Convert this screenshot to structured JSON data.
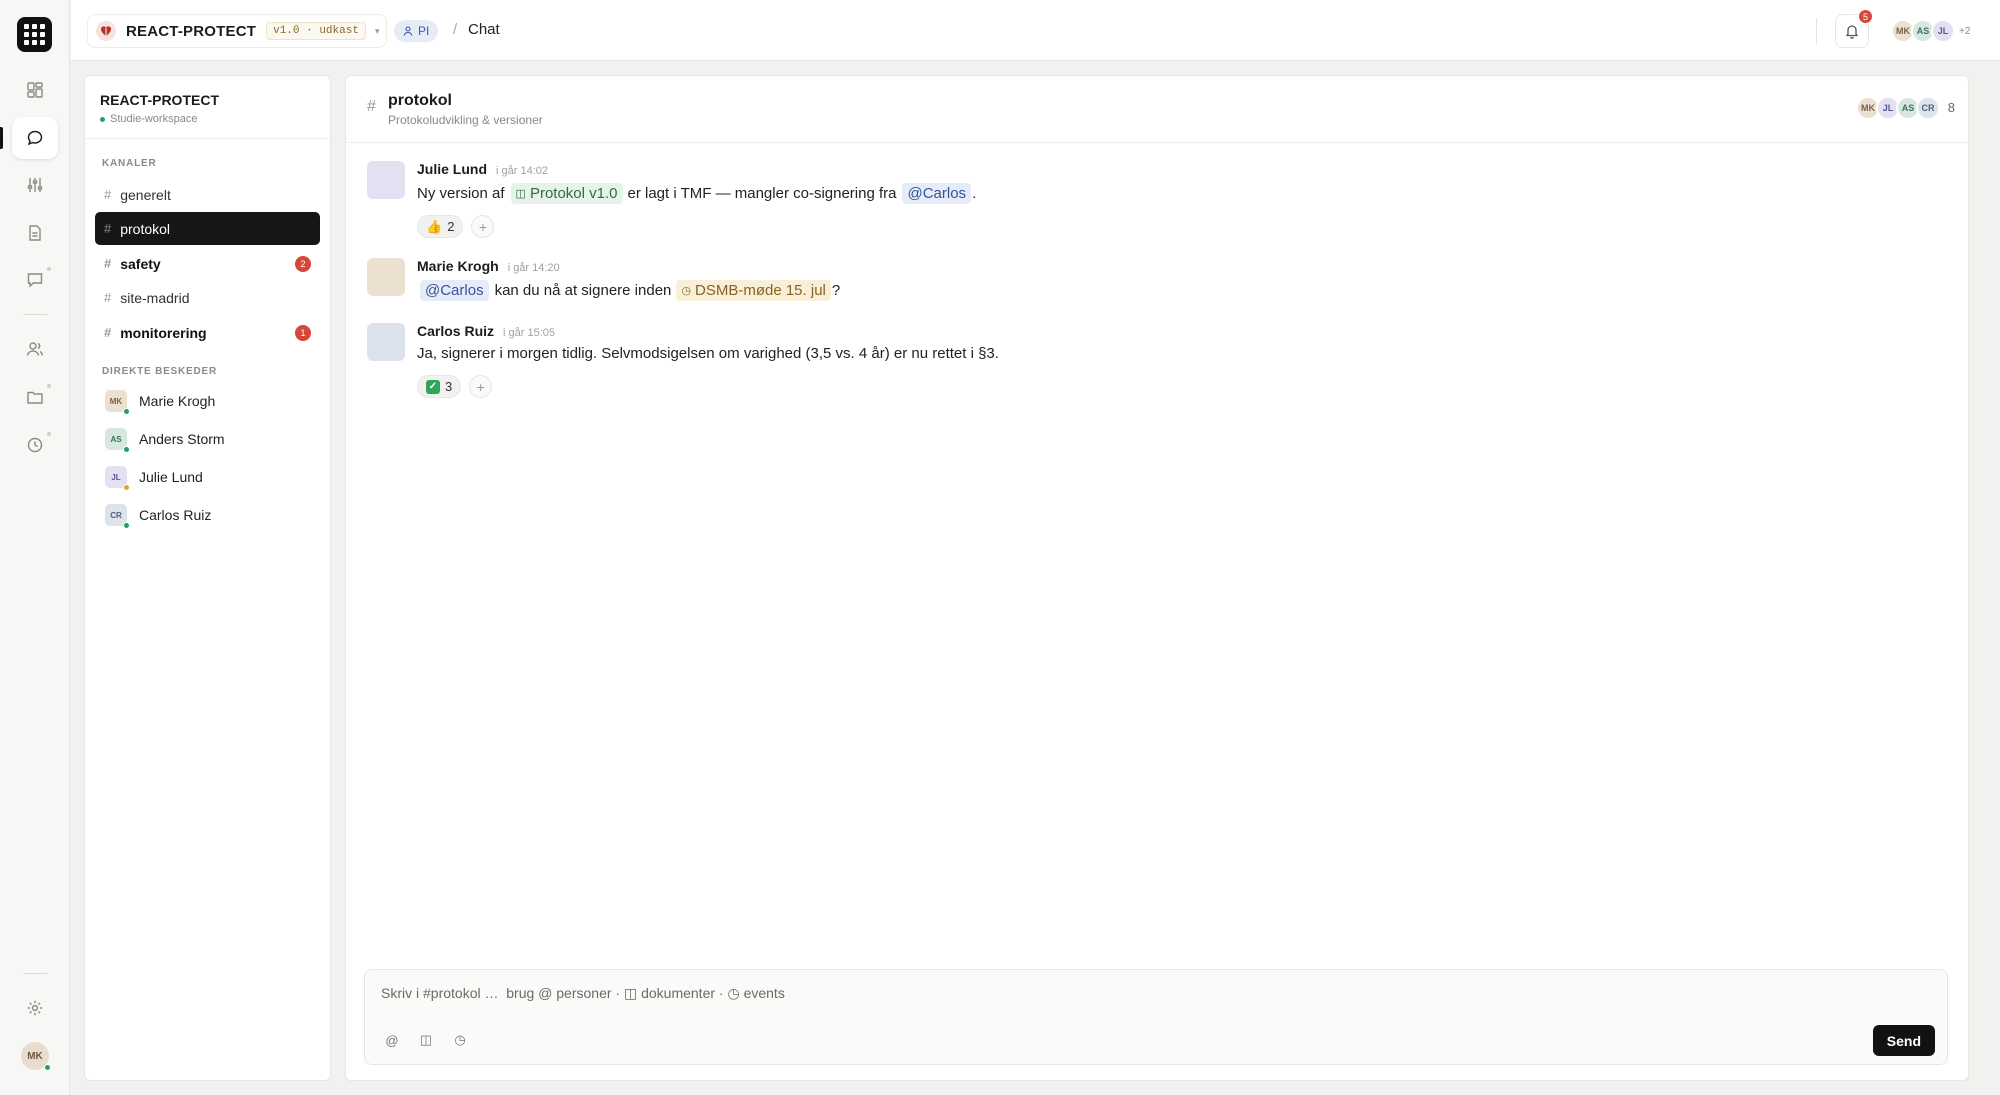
{
  "topbar": {
    "project": "REACT-PROTECT",
    "version": "v1.0 · udkast",
    "role": "PI",
    "separator": "/",
    "crumb": "Chat",
    "notifications": "5",
    "members": [
      "MK",
      "AS",
      "JL"
    ],
    "members_more": "+2"
  },
  "rail": {
    "items": [
      "dashboard-icon",
      "chat-icon",
      "sliders-icon",
      "document-icon",
      "comments-icon",
      "people-icon",
      "folder-icon",
      "clock-icon",
      "gear-icon"
    ],
    "user_initials": "MK"
  },
  "sidebar": {
    "workspace": "REACT-PROTECT",
    "workspace_sub": "Studie-workspace",
    "channels_label": "KANALER",
    "channels": [
      {
        "name": "generelt",
        "count": ""
      },
      {
        "name": "protokol",
        "count": ""
      },
      {
        "name": "safety",
        "count": "2"
      },
      {
        "name": "site-madrid",
        "count": ""
      },
      {
        "name": "monitorering",
        "count": "1"
      }
    ],
    "dm_label": "DIREKTE BESKEDER",
    "dms": [
      {
        "initials": "MK",
        "name": "Marie Krogh",
        "status_color": "#22a05a"
      },
      {
        "initials": "AS",
        "name": "Anders Storm",
        "status_color": "#22a05a"
      },
      {
        "initials": "JL",
        "name": "Julie Lund",
        "status_color": "#e0a52a"
      },
      {
        "initials": "CR",
        "name": "Carlos Ruiz",
        "status_color": "#22a05a"
      }
    ]
  },
  "channel": {
    "hash": "#",
    "title": "protokol",
    "subtitle": "Protokoludvikling & versioner",
    "members": [
      "MK",
      "JL",
      "AS",
      "CR"
    ],
    "member_count": "8"
  },
  "messages": [
    {
      "author": "Julie Lund",
      "time": "i går 14:02",
      "text1": "Ny version af",
      "doc_chip": "Protokol v1.0",
      "text2": "er lagt i TMF — mangler co-signering fra",
      "mention": "@Carlos",
      "text3": ".",
      "reaction_emoji": "👍",
      "reaction_count": "2"
    },
    {
      "author": "Marie Krogh",
      "time": "i går 14:20",
      "mention": "@Carlos",
      "text1": "kan du nå at signere inden",
      "event_chip": "DSMB-møde 15. jul",
      "text2": "?"
    },
    {
      "author": "Carlos Ruiz",
      "time": "i går 15:05",
      "text1": "Ja, signerer i morgen tidlig. Selvmodsigelsen om varighed (3,5 vs. 4 år) er nu rettet i §3.",
      "reaction_emoji": "✓",
      "reaction_count": "3"
    }
  ],
  "composer": {
    "placeholder": "Skriv i #protokol …  brug @ personer · ◫ dokumenter · ◷ events",
    "tools": [
      "@",
      "◫",
      "◷"
    ],
    "send_label": "Send"
  },
  "colors": {
    "accent_dark": "#121212",
    "badge_red": "#d6463a",
    "online_green": "#22a05a",
    "doc_chip_bg": "#e7f3ea",
    "mention_chip_bg": "#e6ecf7",
    "event_chip_bg": "#f8efd9"
  }
}
